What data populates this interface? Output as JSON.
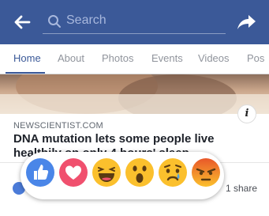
{
  "header": {
    "search_placeholder": "Search"
  },
  "tabs": [
    {
      "label": "Home",
      "active": true
    },
    {
      "label": "About",
      "active": false
    },
    {
      "label": "Photos",
      "active": false
    },
    {
      "label": "Events",
      "active": false
    },
    {
      "label": "Videos",
      "active": false
    },
    {
      "label": "Pos",
      "active": false
    }
  ],
  "post": {
    "source": "NEWSCIENTIST.COM",
    "headline": "DNA mutation lets some people live healthily on only 4 hours' sleep",
    "share_count": "1 share"
  },
  "reactions": [
    {
      "name": "like"
    },
    {
      "name": "love"
    },
    {
      "name": "haha"
    },
    {
      "name": "wow"
    },
    {
      "name": "sad"
    },
    {
      "name": "angry"
    }
  ],
  "colors": {
    "brand": "#3b5998",
    "like": "#4a86e8",
    "love": "#f0506e",
    "emoji": "#fbc02d",
    "angry": "#e8572a"
  }
}
